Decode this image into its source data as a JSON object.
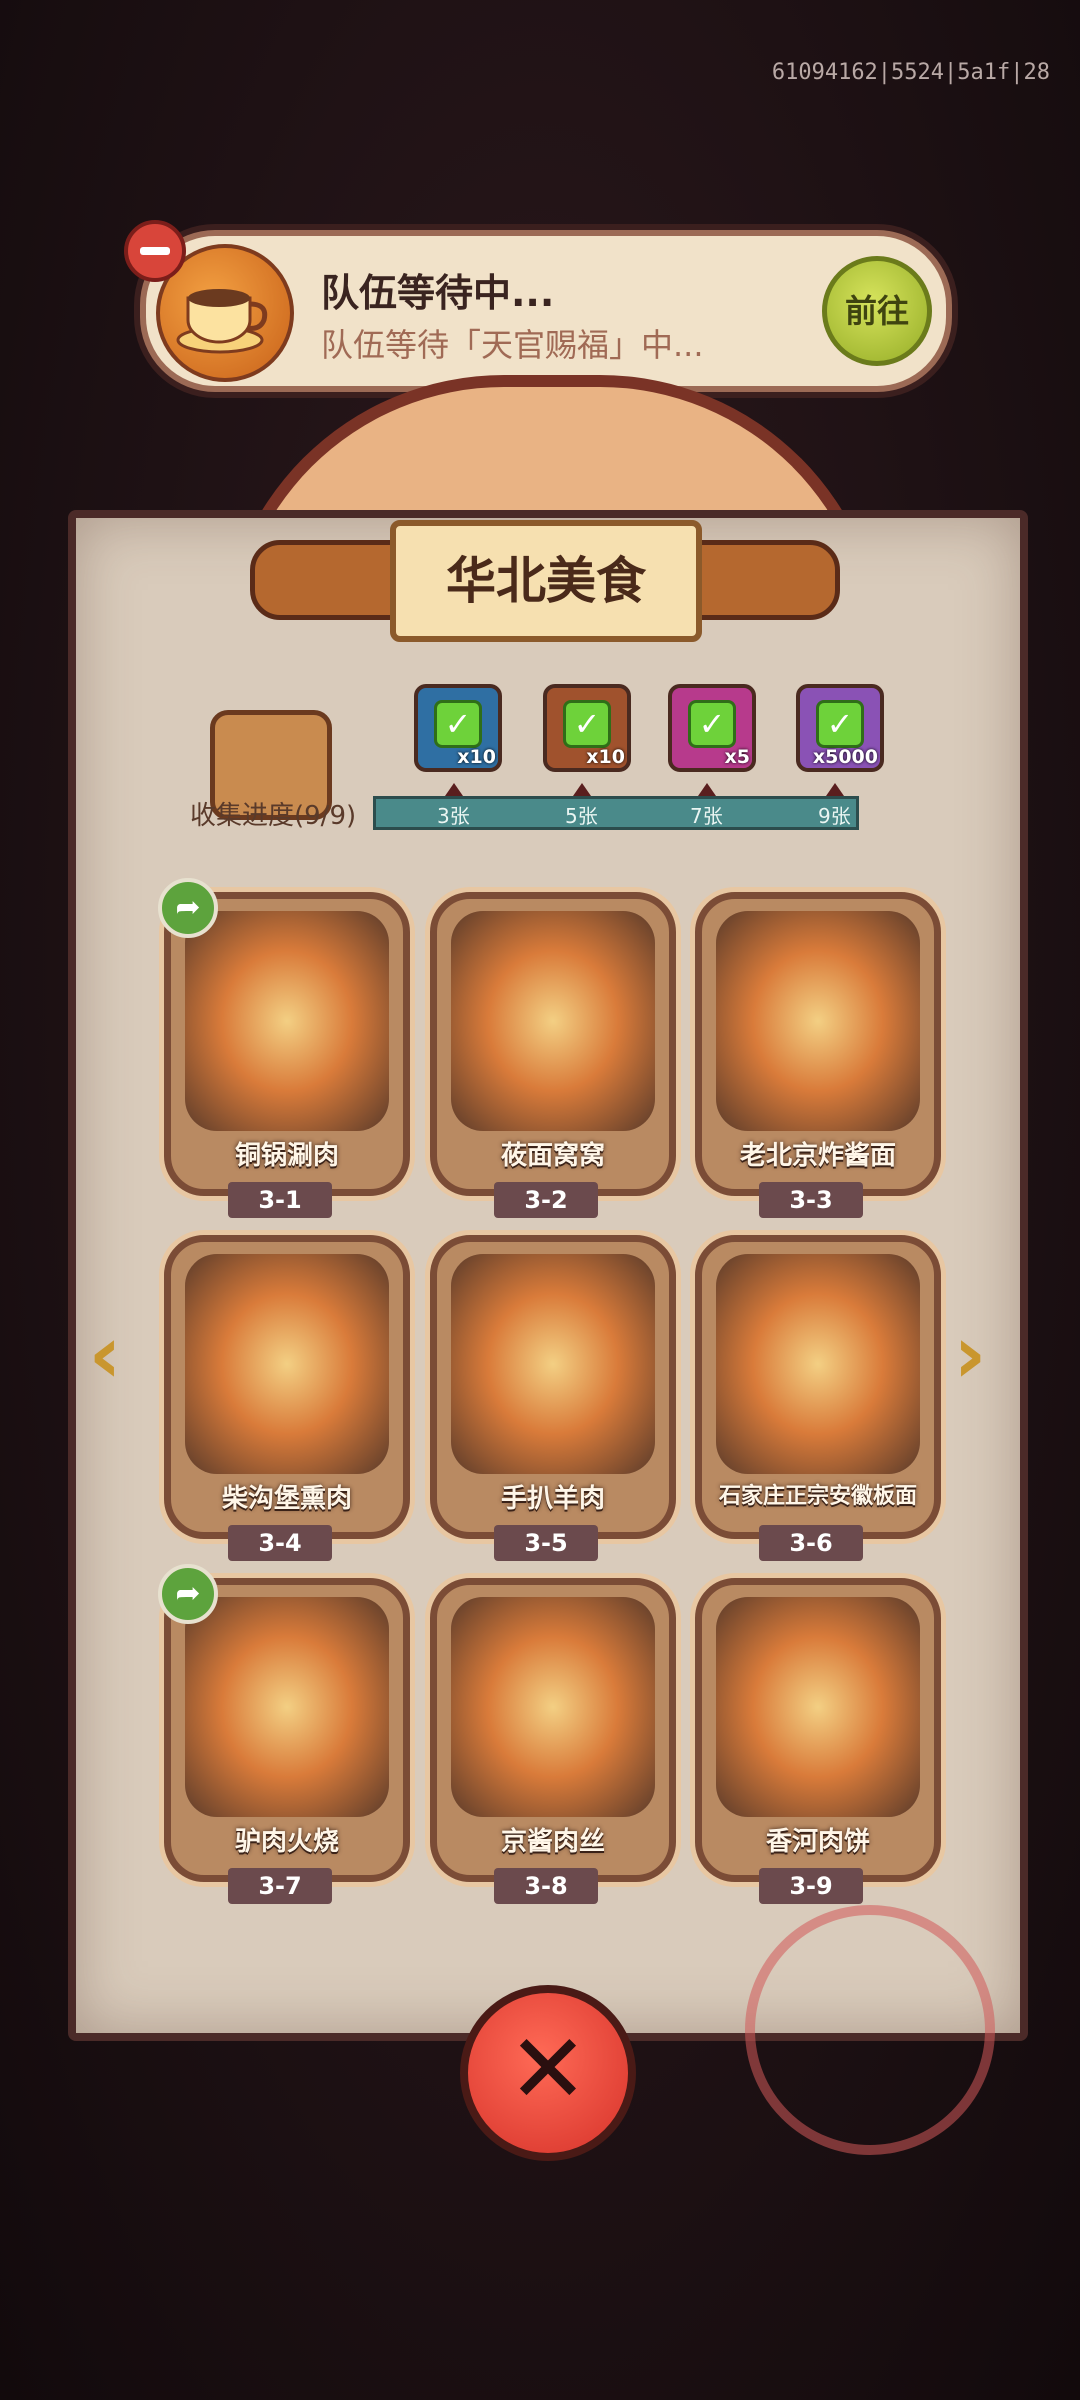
{
  "debug_text": "61094162|5524|5a1f|28",
  "team_banner": {
    "title": "队伍等待中...",
    "subtitle": "队伍等待「天官赐福」中...",
    "go_label": "前往"
  },
  "album": {
    "title": "华北美食",
    "progress_label": "收集进度(9/9)",
    "milestones": [
      {
        "label": "3张",
        "count": "x10",
        "icon": "treasure-chest-icon",
        "color": "#2f6fa3",
        "claimed": true
      },
      {
        "label": "5张",
        "count": "x10",
        "icon": "scroll-icon",
        "color": "#a0522d",
        "claimed": true
      },
      {
        "label": "7张",
        "count": "x5",
        "icon": "magic-orb-icon",
        "color": "#b73a8c",
        "claimed": true
      },
      {
        "label": "9张",
        "count": "x5000",
        "icon": "silver-gem-icon",
        "color": "#8a52b5",
        "claimed": true
      }
    ],
    "cards": [
      {
        "name": "铜锅涮肉",
        "code": "3-1",
        "shared": true
      },
      {
        "name": "莜面窝窝",
        "code": "3-2",
        "shared": false
      },
      {
        "name": "老北京炸酱面",
        "code": "3-3",
        "shared": false
      },
      {
        "name": "柴沟堡熏肉",
        "code": "3-4",
        "shared": false
      },
      {
        "name": "手扒羊肉",
        "code": "3-5",
        "shared": false
      },
      {
        "name": "石家庄正宗安徽板面",
        "code": "3-6",
        "shared": false
      },
      {
        "name": "驴肉火烧",
        "code": "3-7",
        "shared": true
      },
      {
        "name": "京酱肉丝",
        "code": "3-8",
        "shared": false
      },
      {
        "name": "香河肉饼",
        "code": "3-9",
        "shared": false
      }
    ]
  },
  "icons": {
    "remove": "minus-icon",
    "coffee": "coffee-cup-icon",
    "share": "share-arrow-icon",
    "prev": "chevron-left-icon",
    "next": "chevron-right-icon",
    "close": "close-icon"
  }
}
